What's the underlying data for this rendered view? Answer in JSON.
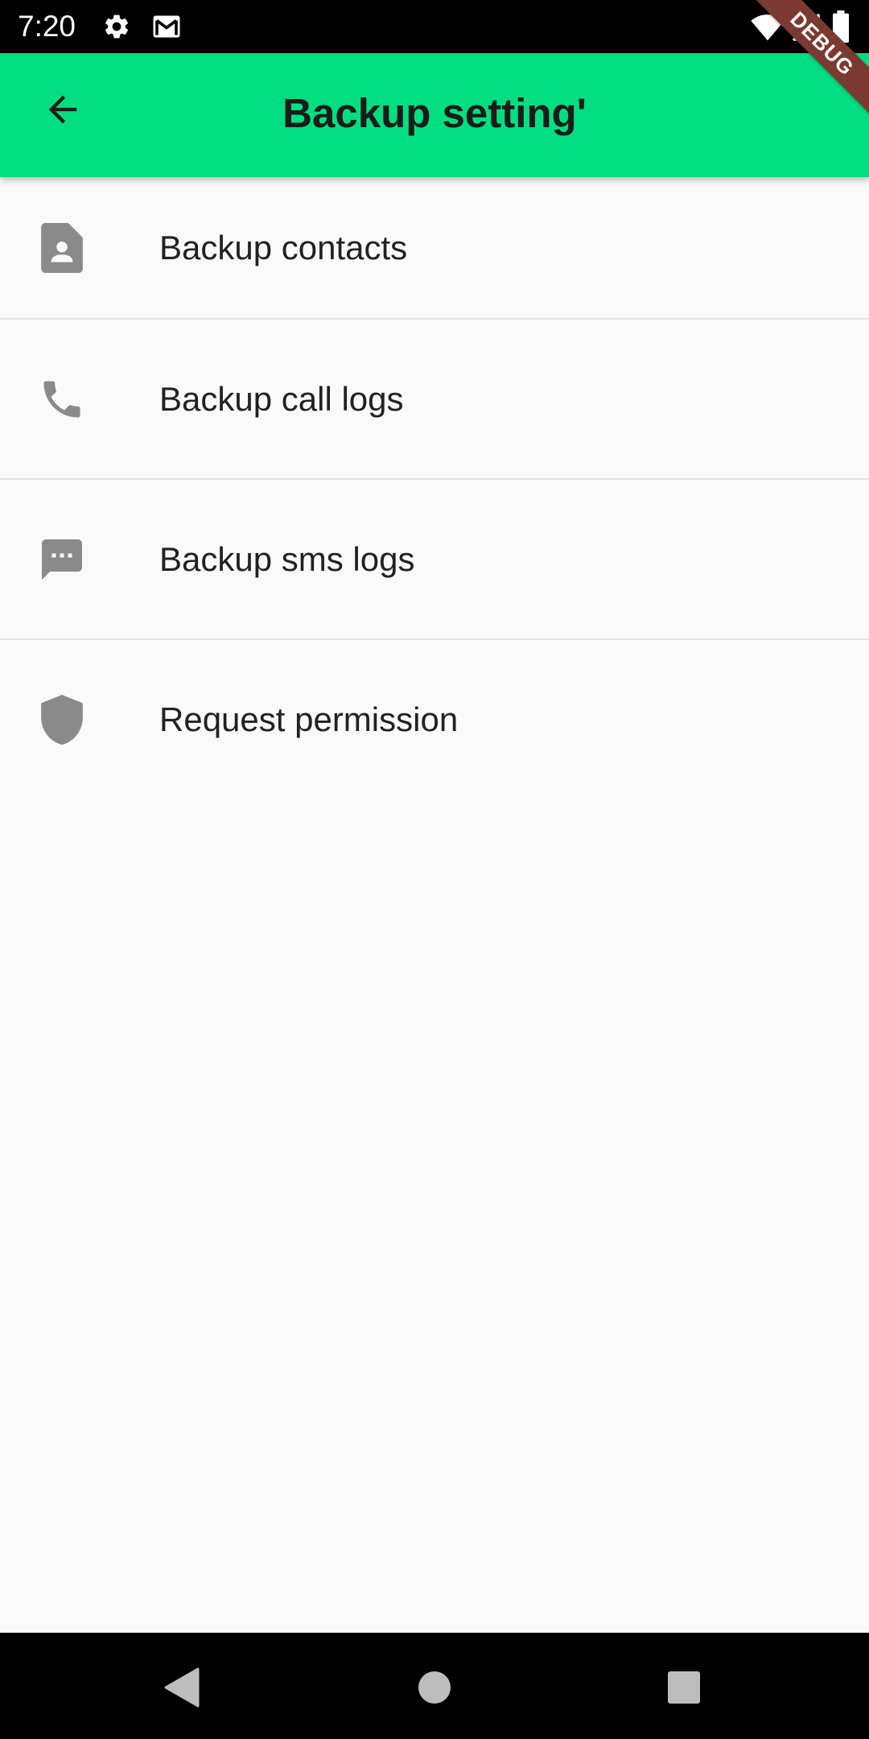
{
  "status_bar": {
    "time": "7:20",
    "icons": [
      "settings-icon",
      "gmail-icon",
      "wifi-icon",
      "signal-icon",
      "battery-icon"
    ]
  },
  "app_bar": {
    "title": "Backup setting'",
    "back_icon": "arrow-back-icon",
    "background_color": "#00de80"
  },
  "debug_banner": {
    "label": "DEBUG",
    "color": "#7a3a31"
  },
  "list": {
    "items": [
      {
        "icon": "contact-file-icon",
        "label": "Backup contacts"
      },
      {
        "icon": "phone-icon",
        "label": "Backup call logs"
      },
      {
        "icon": "sms-icon",
        "label": "Backup sms logs"
      },
      {
        "icon": "shield-icon",
        "label": "Request permission"
      }
    ],
    "icon_color": "#8a8a8a"
  },
  "nav_bar": {
    "buttons": [
      "nav-back-icon",
      "nav-home-icon",
      "nav-recents-icon"
    ]
  }
}
